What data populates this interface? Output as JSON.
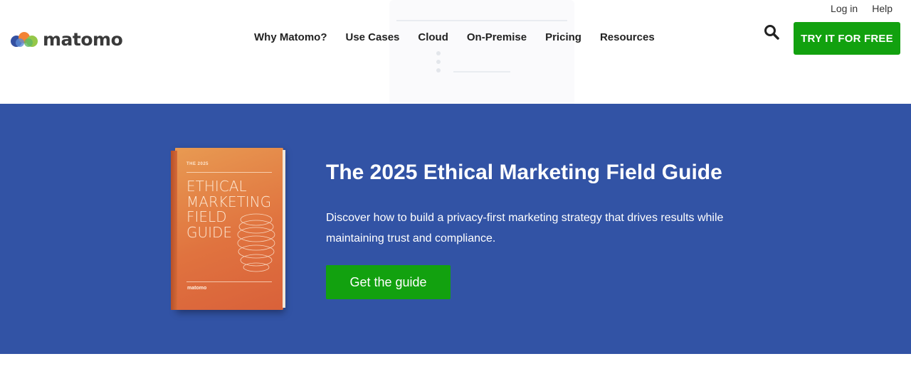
{
  "brand": {
    "name": "matomo"
  },
  "topbar": {
    "login": "Log in",
    "help": "Help"
  },
  "nav": {
    "items": [
      "Why Matomo?",
      "Use Cases",
      "Cloud",
      "On-Premise",
      "Pricing",
      "Resources"
    ]
  },
  "header": {
    "cta": "TRY IT FOR FREE",
    "search_icon": "search-icon"
  },
  "hero": {
    "title": "The 2025 Ethical Marketing Field Guide",
    "description": "Discover how to build a privacy-first marketing strategy that drives results while maintaining trust and compliance.",
    "cta": "Get the guide",
    "book": {
      "year": "THE 2025",
      "title_lines": [
        "ETHICAL",
        "MARKETING",
        "FIELD",
        "GUIDE"
      ],
      "brand": "matomo"
    }
  },
  "colors": {
    "accent_green": "#12a10f",
    "hero_blue": "#3253a5",
    "book_orange": "#e0733f"
  }
}
